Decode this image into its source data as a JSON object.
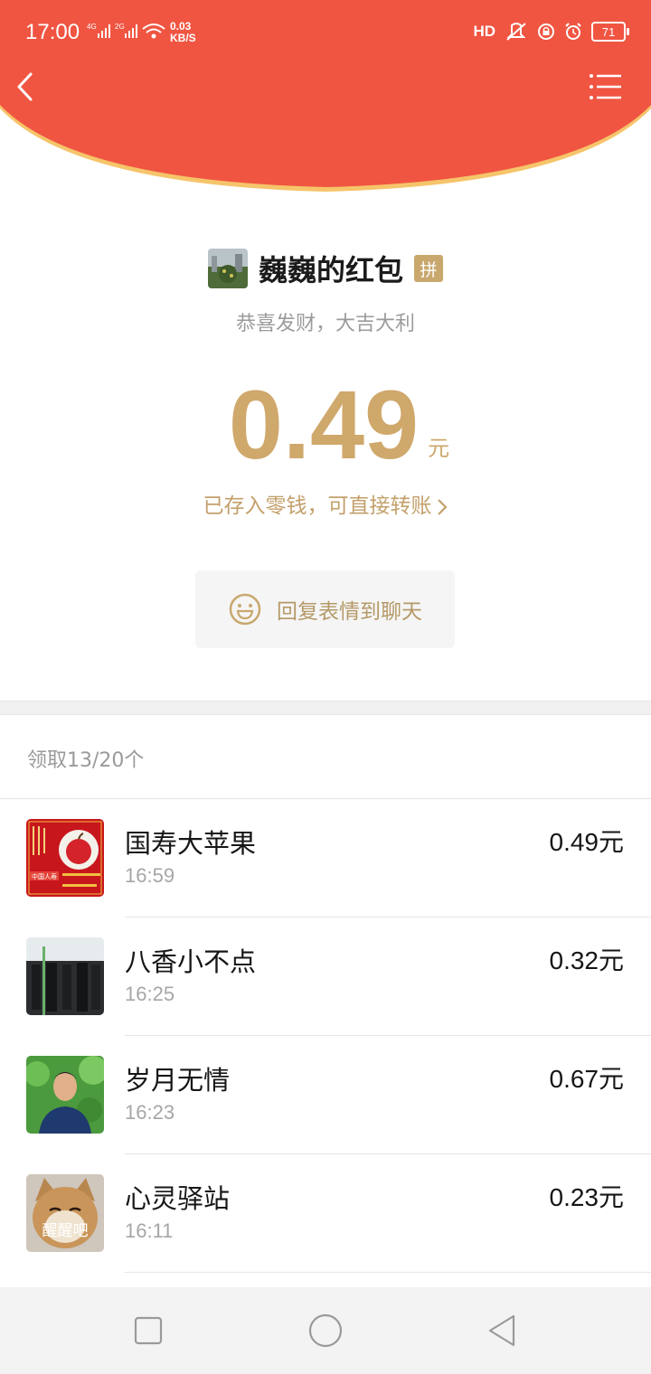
{
  "status_bar": {
    "time": "17:00",
    "net1": "4G",
    "net2": "2G",
    "speed_value": "0.03",
    "speed_unit": "KB/S",
    "hd_label": "HD",
    "battery": "71"
  },
  "nav": {
    "back_icon": "chevron-left-icon",
    "menu_icon": "list-icon"
  },
  "packet": {
    "sender_name": "巍巍的红包",
    "badge": "拼",
    "wish": "恭喜发财，大吉大利",
    "amount": "0.49",
    "amount_unit": "元",
    "saved_note": "已存入零钱，可直接转账",
    "reply_label": "回复表情到聊天"
  },
  "claims": {
    "count_label": "领取13/20个",
    "rows": [
      {
        "name": "国寿大苹果",
        "time": "16:59",
        "amount": "0.49元"
      },
      {
        "name": "八香小不点",
        "time": "16:25",
        "amount": "0.32元"
      },
      {
        "name": "岁月无情",
        "time": "16:23",
        "amount": "0.67元"
      },
      {
        "name": "心灵驿站",
        "time": "16:11",
        "amount": "0.23元"
      }
    ]
  },
  "avatar_text": {
    "row1_tag": "中国人寿",
    "row4_caption": "醒醒吧"
  },
  "colors": {
    "header_red": "#f05542",
    "header_gold_rim": "#f6c46a",
    "gold_text": "#cfa86b"
  }
}
